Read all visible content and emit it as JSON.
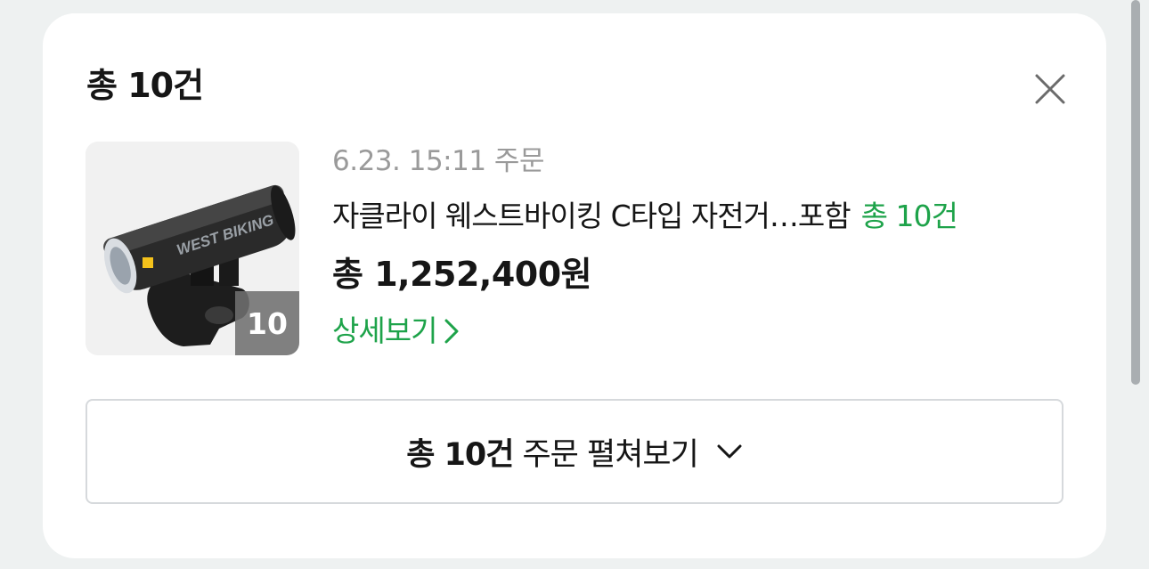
{
  "header": {
    "title": "총 10건",
    "close_icon": "close-icon"
  },
  "order": {
    "thumbnail_brand_text": "WEST BIKING",
    "thumbnail_count": "10",
    "date": "6.23. 15:11 주문",
    "product_name": "자클라이 웨스트바이킹 C타입 자전거…포함",
    "product_count": "총 10건",
    "total": "총 1,252,400원",
    "detail_link": "상세보기"
  },
  "expand": {
    "bold_label": "총 10건",
    "label": "주문 펼쳐보기",
    "icon": "chevron-down-icon"
  },
  "colors": {
    "accent_green": "#1ea34a",
    "text_primary": "#161616",
    "text_muted": "#9a9a9a",
    "background": "#eef1f1",
    "card": "#ffffff"
  }
}
